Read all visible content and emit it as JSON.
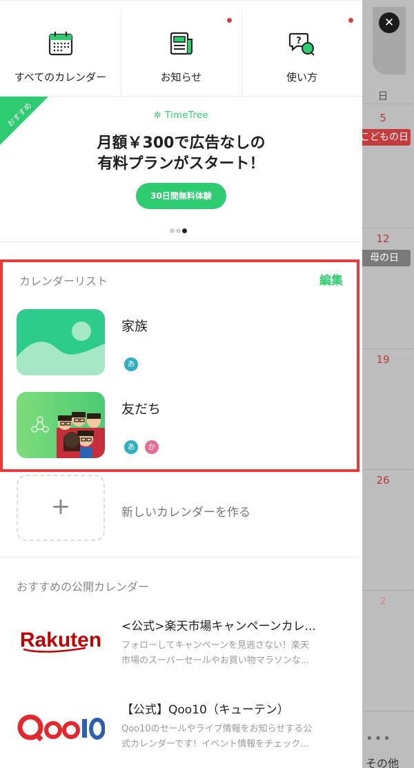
{
  "background_calendar": {
    "close_icon": "close-icon",
    "day_header": "日",
    "dates": [
      {
        "label": "5",
        "holiday": "こどもの日"
      },
      {
        "label": "12",
        "holiday": "母の日"
      },
      {
        "label": "19"
      },
      {
        "label": "26"
      },
      {
        "label": "2"
      }
    ],
    "more_label": "•••",
    "other_label": "その他"
  },
  "top_nav": [
    {
      "label": "すべてのカレンダー",
      "icon": "calendar-icon",
      "has_dot": false
    },
    {
      "label": "お知らせ",
      "icon": "newspaper-icon",
      "has_dot": true
    },
    {
      "label": "使い方",
      "icon": "help-chat-icon",
      "has_dot": true
    }
  ],
  "promo": {
    "ribbon": "おすすめ",
    "brand": "TimeTree",
    "title_line1": "月額￥300で広告なしの",
    "title_line2": "有料プランがスタート！",
    "cta": "30日間無料体験",
    "page_count": 3,
    "active_page": 3
  },
  "calendar_list": {
    "heading": "カレンダーリスト",
    "edit_label": "編集",
    "items": [
      {
        "name": "家族",
        "members": [
          "あ"
        ]
      },
      {
        "name": "友だち",
        "members": [
          "あ",
          "か"
        ]
      }
    ]
  },
  "new_calendar": {
    "plus": "+",
    "label": "新しいカレンダーを作る"
  },
  "public_calendars": {
    "heading": "おすすめの公開カレンダー",
    "items": [
      {
        "logo_text": "Rakuten",
        "title": "<公式>楽天市場キャンペーンカレ...",
        "desc_line1": "フォローしてキャンペーンを見逃さない！楽天",
        "desc_line2": "市場のスーパーセールやお買い物マラソンな..."
      },
      {
        "logo_text": "Qoo10",
        "title": "【公式】Qoo10（キューテン）",
        "desc_line1": "Qoo10のセールやライブ情報をお知らせする公",
        "desc_line2": "式カレンダーです！イベント情報をチェック..."
      }
    ]
  },
  "colors": {
    "accent": "#2ecc71",
    "highlight_border": "#e83a3a",
    "rakuten_red": "#bf0000",
    "qoo10_red": "#e4262d",
    "qoo10_blue": "#2c5fb3"
  }
}
